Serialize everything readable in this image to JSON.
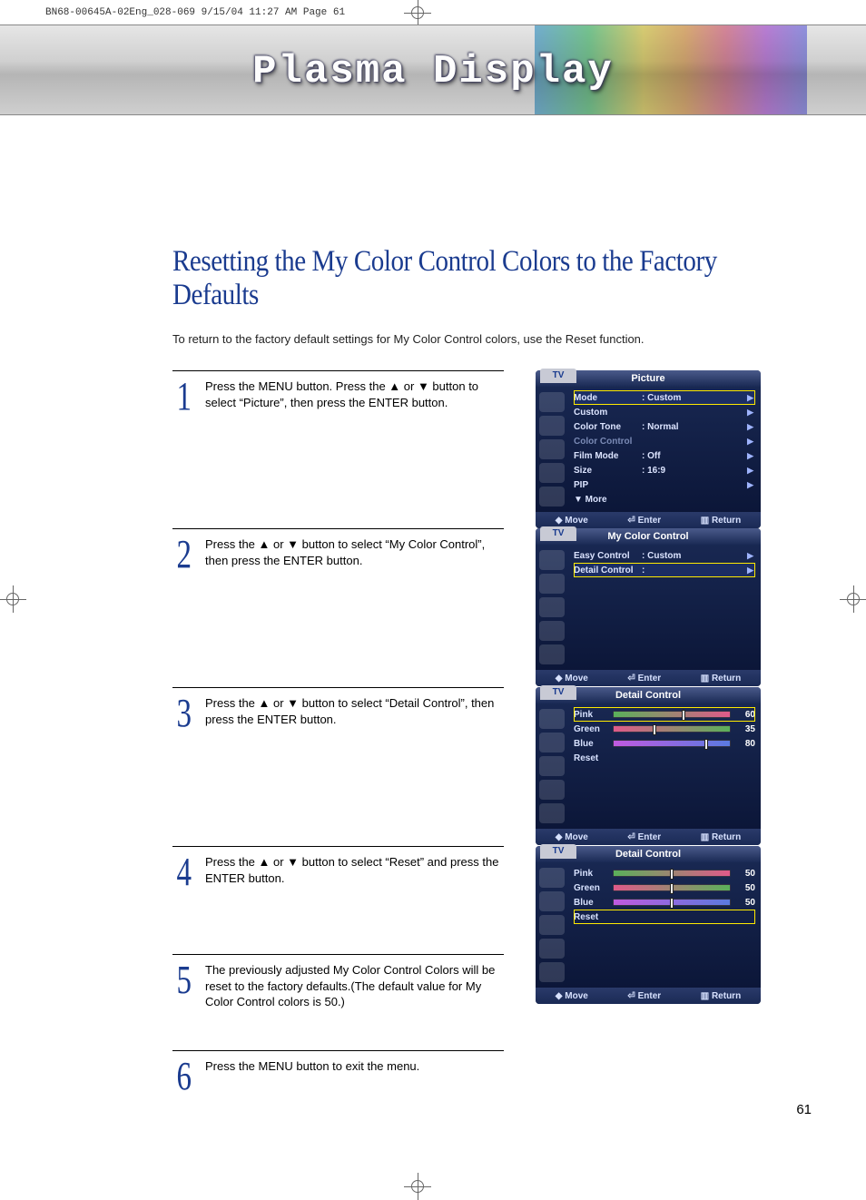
{
  "meta_line": "BN68-00645A-02Eng_028-069  9/15/04  11:27 AM  Page 61",
  "banner_title": "Plasma Display",
  "page_title": "Resetting the My Color Control Colors to the Factory Defaults",
  "intro": "To return to the factory default settings for My Color Control colors, use the Reset function.",
  "steps": [
    "Press the MENU button. Press the ▲ or ▼ button to select “Picture”, then press the ENTER button.",
    "Press the ▲ or ▼ button to select “My Color Control”, then press the ENTER button.",
    "Press the ▲ or ▼ button to select “Detail Control”, then press the ENTER button.",
    "Press the ▲ or ▼ button to select “Reset” and press the ENTER button.",
    "The previously adjusted My Color Control Colors will be reset to the factory defaults.(The default value for My Color Control colors is 50.)",
    "Press the MENU button to exit the menu."
  ],
  "osd_common": {
    "tv": "TV",
    "move": "Move",
    "enter": "Enter",
    "return": "Return"
  },
  "osd1": {
    "title": "Picture",
    "rows": [
      {
        "label": "Mode",
        "value": ": Custom",
        "sel": true
      },
      {
        "label": "Custom",
        "value": ""
      },
      {
        "label": "Color Tone",
        "value": ": Normal"
      },
      {
        "label": "Color Control",
        "value": "",
        "dim": true
      },
      {
        "label": "Film Mode",
        "value": ": Off"
      },
      {
        "label": "Size",
        "value": ": 16:9"
      },
      {
        "label": "PIP",
        "value": ""
      },
      {
        "label": "▼ More",
        "value": "",
        "noarrow": true
      }
    ]
  },
  "osd2": {
    "title": "My Color Control",
    "rows": [
      {
        "label": "Easy Control",
        "value": ": Custom"
      },
      {
        "label": "Detail Control",
        "value": ":",
        "sel": true
      }
    ]
  },
  "osd3": {
    "title": "Detail Control",
    "sliders": [
      {
        "name": "Pink",
        "value": 60,
        "color1": "#5ab05a",
        "color2": "#e05a8a",
        "sel": true
      },
      {
        "name": "Green",
        "value": 35,
        "color1": "#e05a8a",
        "color2": "#5ab05a"
      },
      {
        "name": "Blue",
        "value": 80,
        "color1": "#c05ae0",
        "color2": "#5a7ae0"
      }
    ],
    "reset": "Reset"
  },
  "osd4": {
    "title": "Detail Control",
    "sliders": [
      {
        "name": "Pink",
        "value": 50,
        "color1": "#5ab05a",
        "color2": "#e05a8a"
      },
      {
        "name": "Green",
        "value": 50,
        "color1": "#e05a8a",
        "color2": "#5ab05a"
      },
      {
        "name": "Blue",
        "value": 50,
        "color1": "#c05ae0",
        "color2": "#5a7ae0"
      }
    ],
    "reset": "Reset",
    "reset_sel": true
  },
  "page_number": "61"
}
